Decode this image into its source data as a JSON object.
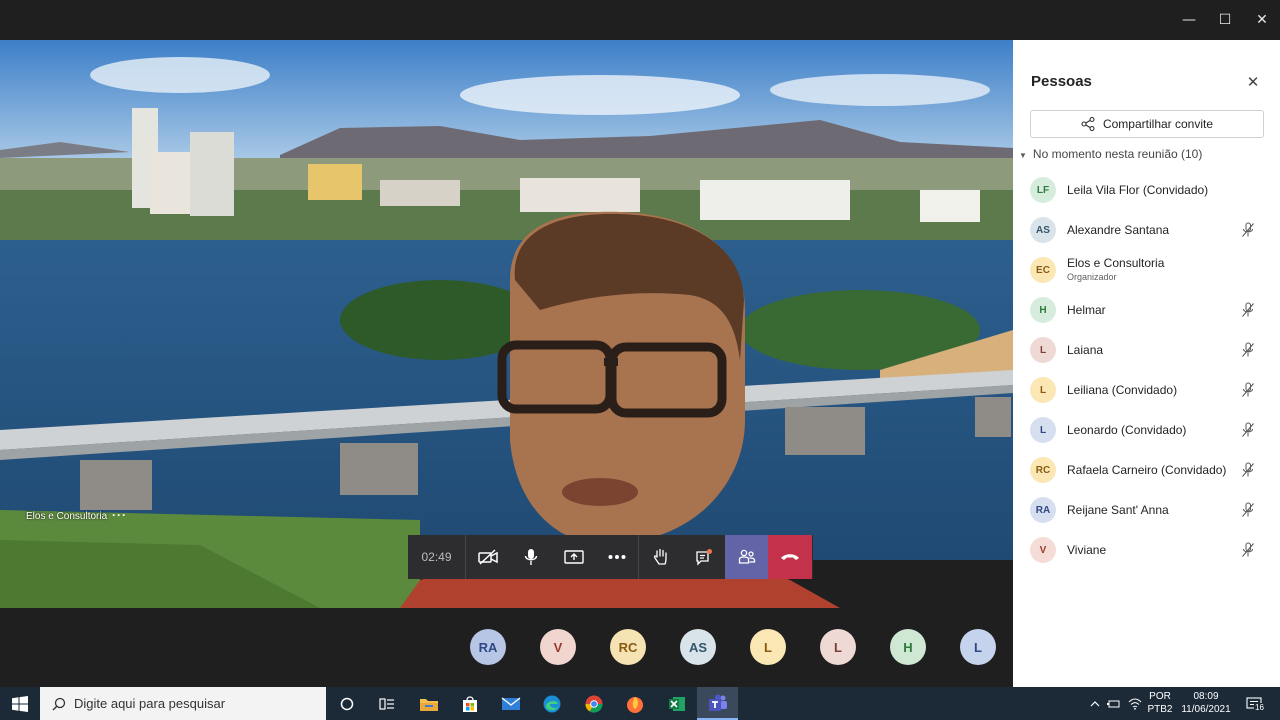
{
  "window": {
    "minimize": "—",
    "maximize": "☐",
    "close": "✕"
  },
  "meeting": {
    "speaker_name": "Elos e Consultoria",
    "speaker_more": "···",
    "timer": "02:49"
  },
  "strip_avatars": [
    {
      "initials": "RA",
      "bg": "#b8c6e6",
      "fg": "#2e4884"
    },
    {
      "initials": "V",
      "bg": "#f1d6d0",
      "fg": "#9a3b2b"
    },
    {
      "initials": "RC",
      "bg": "#f6e3b4",
      "fg": "#8a5a12"
    },
    {
      "initials": "AS",
      "bg": "#d8e3ea",
      "fg": "#34566b"
    },
    {
      "initials": "L",
      "bg": "#fbe7b4",
      "fg": "#8a5a12"
    },
    {
      "initials": "L",
      "bg": "#efd9d4",
      "fg": "#7a4035"
    },
    {
      "initials": "H",
      "bg": "#cfe8d3",
      "fg": "#2f7a3d"
    },
    {
      "initials": "L",
      "bg": "#c6d3ec",
      "fg": "#2e4884"
    }
  ],
  "panel": {
    "title": "Pessoas",
    "close": "✕",
    "share_label": "Compartilhar convite",
    "section_label": "No momento nesta reunião (10)",
    "people": [
      {
        "initials": "LF",
        "name": "Leila Vila Flor (Convidado)",
        "role": "",
        "muted": false,
        "bg": "#d6ecdc",
        "fg": "#2f7a3d"
      },
      {
        "initials": "AS",
        "name": "Alexandre Santana",
        "role": "",
        "muted": true,
        "bg": "#d8e3ea",
        "fg": "#34566b"
      },
      {
        "initials": "EC",
        "name": "Elos e Consultoria",
        "role": "Organizador",
        "muted": false,
        "bg": "#fbe7b4",
        "fg": "#8a5a12"
      },
      {
        "initials": "H",
        "name": "Helmar",
        "role": "",
        "muted": true,
        "bg": "#d6ecdc",
        "fg": "#2f7a3d"
      },
      {
        "initials": "L",
        "name": "Laiana",
        "role": "",
        "muted": true,
        "bg": "#efd9d4",
        "fg": "#7a4035"
      },
      {
        "initials": "L",
        "name": "Leiliana (Convidado)",
        "role": "",
        "muted": true,
        "bg": "#fbe7b4",
        "fg": "#8a5a12"
      },
      {
        "initials": "L",
        "name": "Leonardo (Convidado)",
        "role": "",
        "muted": true,
        "bg": "#d6dff0",
        "fg": "#2e4884"
      },
      {
        "initials": "RC",
        "name": "Rafaela Carneiro (Convidado)",
        "role": "",
        "muted": true,
        "bg": "#fbe7b4",
        "fg": "#8a5a12"
      },
      {
        "initials": "RA",
        "name": "Reijane Sant' Anna",
        "role": "",
        "muted": true,
        "bg": "#d6dff0",
        "fg": "#2e4884"
      },
      {
        "initials": "V",
        "name": "Viviane",
        "role": "",
        "muted": true,
        "bg": "#f5dcd6",
        "fg": "#9a3b2b"
      }
    ]
  },
  "taskbar": {
    "search_placeholder": "Digite aqui para pesquisar",
    "lang_top": "POR",
    "lang_bottom": "PTB2",
    "time": "08:09",
    "date": "11/06/2021",
    "notifications": "16",
    "apps": [
      "cortana-icon",
      "task-view-icon",
      "file-explorer-icon",
      "store-icon",
      "mail-icon",
      "edge-icon",
      "chrome-icon",
      "firefox-icon",
      "excel-icon",
      "teams-icon"
    ]
  },
  "colors": {
    "accent": "#6264a7",
    "hangup": "#c4314b",
    "taskbar": "#1c2a38"
  }
}
